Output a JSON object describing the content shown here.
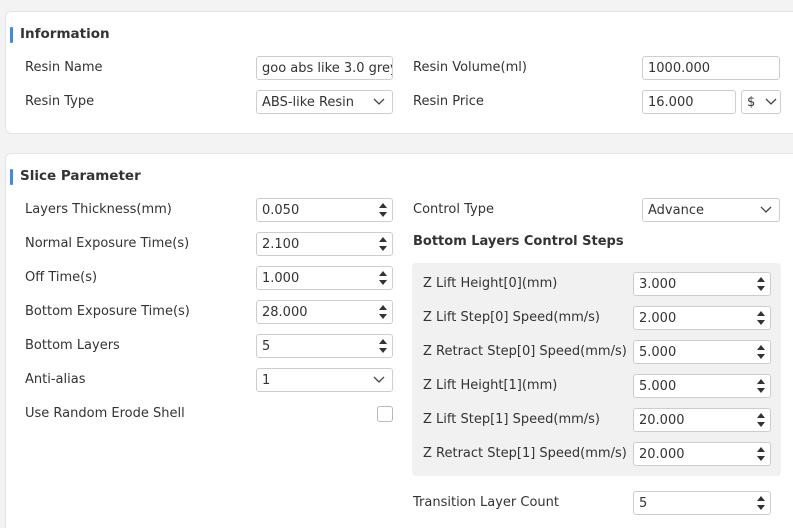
{
  "information": {
    "title": "Information",
    "resin_name_label": "Resin Name",
    "resin_name_value": "goo abs like 3.0 grey",
    "resin_type_label": "Resin Type",
    "resin_type_value": "ABS-like Resin",
    "resin_volume_label": "Resin Volume(ml)",
    "resin_volume_value": "1000.000",
    "resin_price_label": "Resin Price",
    "resin_price_value": "16.000",
    "currency_value": "$"
  },
  "slice": {
    "title": "Slice Parameter",
    "layers_thickness_label": "Layers Thickness(mm)",
    "layers_thickness_value": "0.050",
    "normal_exposure_label": "Normal Exposure Time(s)",
    "normal_exposure_value": "2.100",
    "off_time_label": "Off Time(s)",
    "off_time_value": "1.000",
    "bottom_exposure_label": "Bottom Exposure Time(s)",
    "bottom_exposure_value": "28.000",
    "bottom_layers_label": "Bottom Layers",
    "bottom_layers_value": "5",
    "anti_alias_label": "Anti-alias",
    "anti_alias_value": "1",
    "random_erode_label": "Use Random Erode Shell",
    "control_type_label": "Control Type",
    "control_type_value": "Advance",
    "bottom_steps_title": "Bottom Layers Control Steps",
    "steps": [
      {
        "label": "Z Lift Height[0](mm)",
        "value": "3.000"
      },
      {
        "label": "Z Lift Step[0] Speed(mm/s)",
        "value": "2.000"
      },
      {
        "label": "Z Retract Step[0] Speed(mm/s)",
        "value": "5.000"
      },
      {
        "label": "Z Lift Height[1](mm)",
        "value": "5.000"
      },
      {
        "label": "Z Lift Step[1] Speed(mm/s)",
        "value": "20.000"
      },
      {
        "label": "Z Retract Step[1] Speed(mm/s)",
        "value": "20.000"
      }
    ],
    "transition_label": "Transition Layer Count",
    "transition_value": "5"
  }
}
